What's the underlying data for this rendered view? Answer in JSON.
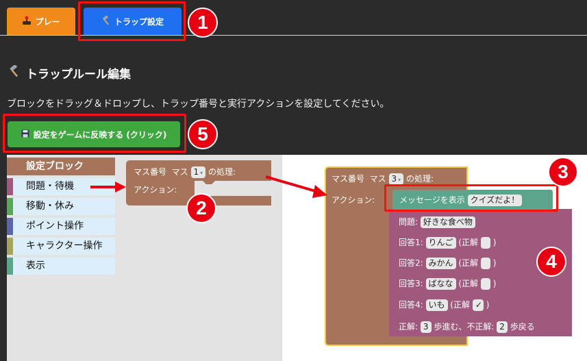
{
  "tabs": [
    {
      "label": "プレー",
      "icon": "joystick-icon"
    },
    {
      "label": "トラップ設定",
      "icon": "hammer-icon"
    }
  ],
  "section": {
    "title": "トラップルール編集"
  },
  "description": "ブロックをドラッグ＆ドロップし、トラップ番号と実行アクションを設定してください。",
  "apply_button": {
    "label": "設定をゲームに反映する (クリック)"
  },
  "toolbox": {
    "header": "設定ブロック",
    "categories": [
      {
        "label": "問題・待機",
        "color": "#a0587d"
      },
      {
        "label": "移動・休み",
        "color": "#5ba55b"
      },
      {
        "label": "ポイント操作",
        "color": "#5b67a5"
      },
      {
        "label": "キャラクター操作",
        "color": "#a5a55b"
      },
      {
        "label": "表示",
        "color": "#5ba58c"
      }
    ]
  },
  "flyout_block": {
    "label_prefix": "マス番号",
    "label_masu": "マス",
    "square": "1",
    "label_suffix": "の処理:",
    "action_label": "アクション:"
  },
  "workspace_block": {
    "label_prefix": "マス番号",
    "label_masu": "マス",
    "square": "3",
    "label_suffix": "の処理:",
    "action_label": "アクション:"
  },
  "message_block": {
    "label": "メッセージを表示",
    "value": "クイズだよ！"
  },
  "quiz_block": {
    "question_label": "問題:",
    "question": "好きな食べ物",
    "answers": [
      {
        "label": "回答1:",
        "text": "りんご",
        "correct_label": "(正解",
        "check": "",
        "close": ")"
      },
      {
        "label": "回答2:",
        "text": "みかん",
        "correct_label": "(正解",
        "check": "",
        "close": ")"
      },
      {
        "label": "回答3:",
        "text": "ばなな",
        "correct_label": "(正解",
        "check": "",
        "close": ")"
      },
      {
        "label": "回答4:",
        "text": "いも",
        "correct_label": "(正解",
        "check": "✓",
        "close": ")"
      }
    ],
    "result_correct_label": "正解:",
    "correct_steps": "3",
    "forward_label": "歩進む、不正解:",
    "wrong_steps": "2",
    "back_label": "歩戻る"
  },
  "annotations": [
    "1",
    "2",
    "3",
    "4",
    "5"
  ],
  "colors": {
    "tab_play": "#f08a1a",
    "tab_trap": "#1f6ff2",
    "apply_button": "#3ea83e",
    "event_block": "#a5745a",
    "message_block": "#5ba58c",
    "quiz_block": "#a0587d",
    "highlight": "#ff1010",
    "marker": "#e60012",
    "selected_outline": "#f5c842"
  }
}
